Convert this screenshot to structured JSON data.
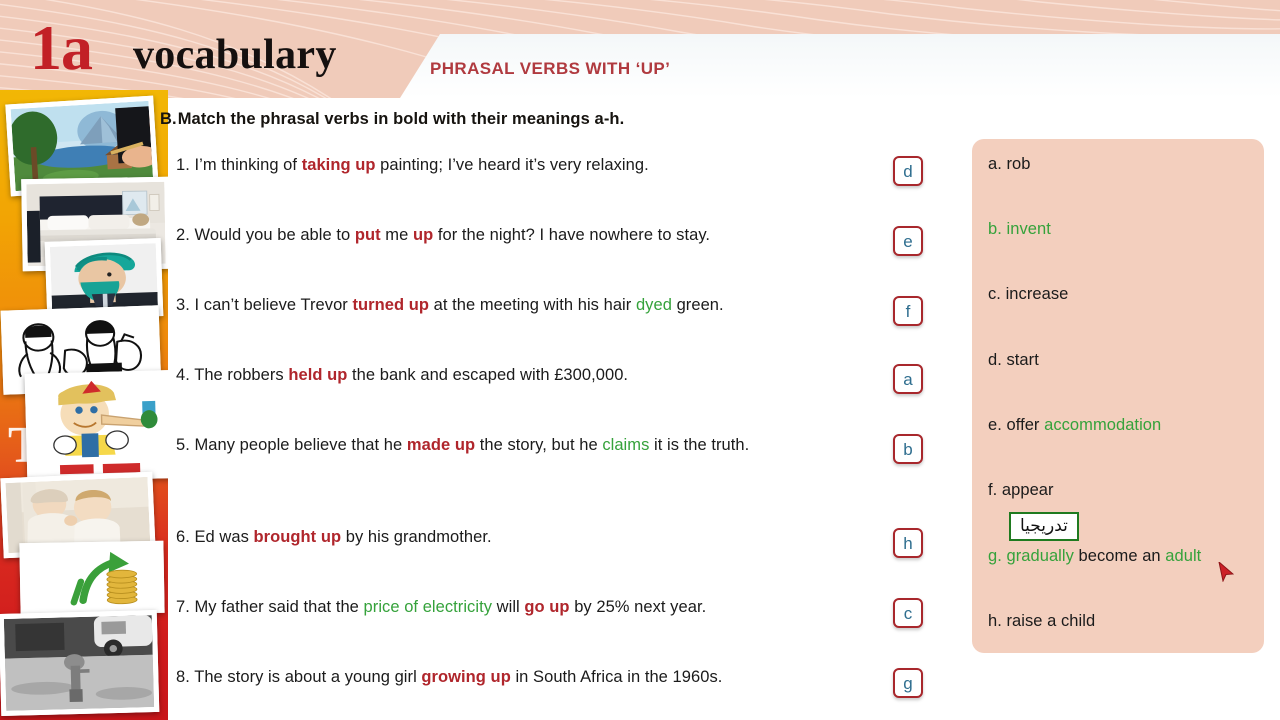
{
  "header": {
    "unit_number": "1a",
    "unit_word": "vocabulary",
    "section_title": "PHRASAL VERBS WITH ‘UP’",
    "rail_ghost_text": "TH",
    "pink_hex": "#f0cbba",
    "accent_red_hex": "#c22026",
    "section_title_hex": "#b03a3f"
  },
  "exercise": {
    "letter": "B.",
    "instruction": "Match the phrasal verbs in bold with their meanings a-h.",
    "questions": [
      {
        "number": "1.",
        "parts": [
          {
            "t": "I’m thinking of ",
            "k": "plain"
          },
          {
            "t": "taking up",
            "k": "verb"
          },
          {
            "t": " painting; I’ve heard it’s very relaxing.",
            "k": "plain"
          }
        ],
        "answer": "d"
      },
      {
        "number": "2.",
        "parts": [
          {
            "t": "Would you be able to ",
            "k": "plain"
          },
          {
            "t": "put",
            "k": "verb"
          },
          {
            "t": " me ",
            "k": "plain"
          },
          {
            "t": "up",
            "k": "verb"
          },
          {
            "t": " for the night? I have nowhere to stay.",
            "k": "plain"
          }
        ],
        "answer": "e"
      },
      {
        "number": "3.",
        "parts": [
          {
            "t": "I can’t believe Trevor ",
            "k": "plain"
          },
          {
            "t": "turned up",
            "k": "verb"
          },
          {
            "t": " at the meeting with his hair ",
            "k": "plain"
          },
          {
            "t": "dyed",
            "k": "gloss"
          },
          {
            "t": " green.",
            "k": "plain"
          }
        ],
        "answer": "f"
      },
      {
        "number": "4.",
        "parts": [
          {
            "t": "The robbers ",
            "k": "plain"
          },
          {
            "t": "held up",
            "k": "verb"
          },
          {
            "t": " the bank and escaped with £300,000.",
            "k": "plain"
          }
        ],
        "answer": "a"
      },
      {
        "number": "5.",
        "parts": [
          {
            "t": "Many people believe that he ",
            "k": "plain"
          },
          {
            "t": "made up",
            "k": "verb"
          },
          {
            "t": " the story, but he ",
            "k": "plain"
          },
          {
            "t": "claims",
            "k": "gloss"
          },
          {
            "t": " it is the truth.",
            "k": "plain"
          }
        ],
        "answer": "b"
      },
      {
        "number": "6.",
        "parts": [
          {
            "t": "Ed was ",
            "k": "plain"
          },
          {
            "t": "brought up",
            "k": "verb"
          },
          {
            "t": " by his grandmother.",
            "k": "plain"
          }
        ],
        "answer": "h"
      },
      {
        "number": "7.",
        "parts": [
          {
            "t": "My father said that the ",
            "k": "plain"
          },
          {
            "t": "price of electricity",
            "k": "gloss"
          },
          {
            "t": " will ",
            "k": "plain"
          },
          {
            "t": "go up",
            "k": "verb"
          },
          {
            "t": " by 25% next year.",
            "k": "plain"
          }
        ],
        "answer": "c"
      },
      {
        "number": "8.",
        "parts": [
          {
            "t": "The story is about a young girl ",
            "k": "plain"
          },
          {
            "t": "growing up",
            "k": "verb"
          },
          {
            "t": " in South Africa in the 1960s.",
            "k": "plain"
          }
        ],
        "answer": "g"
      }
    ]
  },
  "meanings": {
    "panel_hex": "#f3cfbe",
    "items": [
      {
        "label": "a.",
        "parts": [
          {
            "t": "rob",
            "k": "plain"
          }
        ]
      },
      {
        "label": "b.",
        "parts": [
          {
            "t": "invent",
            "k": "gloss"
          }
        ],
        "label_green": true
      },
      {
        "label": "c.",
        "parts": [
          {
            "t": "increase",
            "k": "plain"
          }
        ]
      },
      {
        "label": "d.",
        "parts": [
          {
            "t": "start",
            "k": "plain"
          }
        ]
      },
      {
        "label": "e.",
        "parts": [
          {
            "t": "offer ",
            "k": "plain"
          },
          {
            "t": "accommodation",
            "k": "gloss"
          }
        ]
      },
      {
        "label": "f.",
        "parts": [
          {
            "t": " appear",
            "k": "plain"
          }
        ]
      },
      {
        "label": "g.",
        "parts": [
          {
            "t": "gradually",
            "k": "gloss"
          },
          {
            "t": " become an ",
            "k": "plain"
          },
          {
            "t": "adult",
            "k": "gloss"
          }
        ],
        "label_green": true
      },
      {
        "label": "h.",
        "parts": [
          {
            "t": "raise a child",
            "k": "plain"
          }
        ]
      }
    ]
  },
  "tooltip": {
    "text": "تدريجيا",
    "border_hex": "#1f7a1f"
  },
  "cursor": {
    "icon": "arrow-cursor",
    "color_hex": "#cc2027"
  },
  "photos": [
    {
      "name": "landscape-painting-photo",
      "caption_alt": "painting of mountain lake landscape with hand and brush"
    },
    {
      "name": "bedroom-photo",
      "caption_alt": "made bed in a guest bedroom"
    },
    {
      "name": "teal-hair-man-photo",
      "caption_alt": "man with dyed teal hair and beard"
    },
    {
      "name": "robbers-cartoon-photo",
      "caption_alt": "line-art cartoon of masked robbers with money sacks"
    },
    {
      "name": "pinocchio-photo",
      "caption_alt": "Pinocchio cartoon with long nose and cricket"
    },
    {
      "name": "grandmother-baby-photo",
      "caption_alt": "grandmother feeding a baby"
    },
    {
      "name": "rising-coins-photo",
      "caption_alt": "green arrow rising over stacks of gold coins"
    },
    {
      "name": "girl-street-bw-photo",
      "caption_alt": "black and white photo of a girl standing on a street"
    }
  ]
}
